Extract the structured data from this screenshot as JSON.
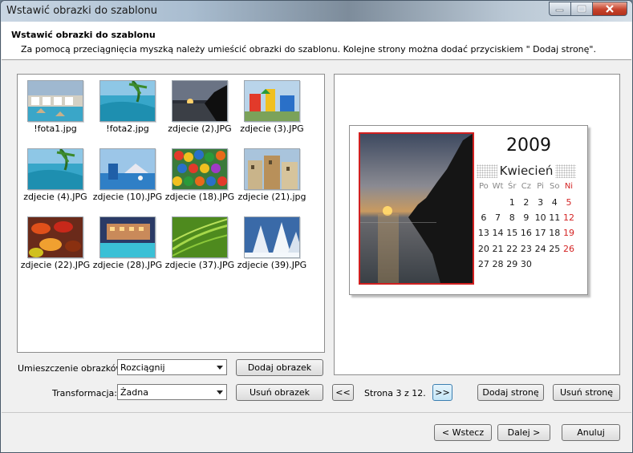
{
  "window": {
    "title": "Wstawić obrazki do szablonu"
  },
  "header": {
    "title": "Wstawić obrazki do szablonu",
    "description": "Za pomocą przeciągnięcia myszką należy umieścić obrazki do szablonu. Kolejne strony można dodać przyciskiem \" Dodaj stronę\"."
  },
  "images": [
    {
      "name": "!fota1.jpg",
      "scene": "resort-pool"
    },
    {
      "name": "!fota2.jpg",
      "scene": "tropical-lagoon"
    },
    {
      "name": "zdjecie (2).JPG",
      "scene": "sunset-sea"
    },
    {
      "name": "zdjecie (3).JPG",
      "scene": "playground"
    },
    {
      "name": "zdjecie (4).JPG",
      "scene": "tropical-lagoon"
    },
    {
      "name": "zdjecie (10).JPG",
      "scene": "water-park"
    },
    {
      "name": "zdjecie (18).JPG",
      "scene": "colorful-balls"
    },
    {
      "name": "zdjecie (21).jpg",
      "scene": "old-town"
    },
    {
      "name": "zdjecie (22).JPG",
      "scene": "autumn-leaves"
    },
    {
      "name": "zdjecie (28).JPG",
      "scene": "hotel-pool"
    },
    {
      "name": "zdjecie (37).JPG",
      "scene": "green-leaf"
    },
    {
      "name": "zdjecie (39).JPG",
      "scene": "snow-trees"
    }
  ],
  "controls": {
    "placement_label": "Umieszczenie obrazków:",
    "placement_value": "Rozciągnij",
    "transform_label": "Transformacja:",
    "transform_value": "Żadna",
    "add_image": "Dodaj obrazek",
    "remove_image": "Usuń obrazek",
    "prev_page": "<<",
    "next_page": ">>",
    "page_info": "Strona 3 z 12.",
    "add_page": "Dodaj stronę",
    "remove_page": "Usuń stronę"
  },
  "calendar": {
    "year": "2009",
    "month": "Kwiecień",
    "weekdays": [
      "Po",
      "Wt",
      "Śr",
      "Cz",
      "Pi",
      "So",
      "Ni"
    ],
    "weeks": [
      [
        "",
        "",
        "1",
        "2",
        "3",
        "4",
        "5"
      ],
      [
        "6",
        "7",
        "8",
        "9",
        "10",
        "11",
        "12"
      ],
      [
        "13",
        "14",
        "15",
        "16",
        "17",
        "18",
        "19"
      ],
      [
        "20",
        "21",
        "22",
        "23",
        "24",
        "25",
        "26"
      ],
      [
        "27",
        "28",
        "29",
        "30",
        "",
        "",
        ""
      ]
    ],
    "sunday_color": "#d42424",
    "photo_border_color": "#d02020"
  },
  "footer": {
    "back": "< Wstecz",
    "next": "Dalej >",
    "cancel": "Anuluj"
  }
}
